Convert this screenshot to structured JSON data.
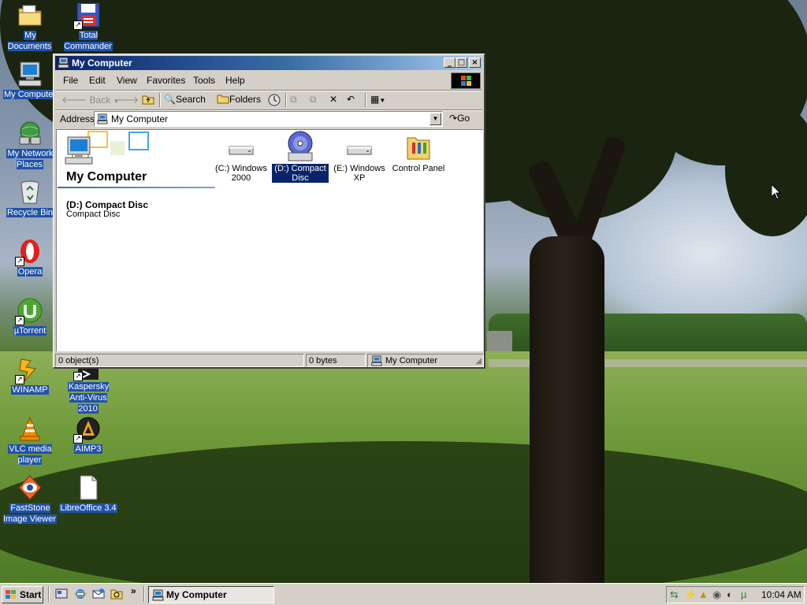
{
  "desktop": {
    "icons": [
      {
        "label": "My Documents",
        "icon": "folder-documents-icon"
      },
      {
        "label": "Total Commander",
        "icon": "floppy-disk-icon"
      },
      {
        "label": "My Computer",
        "icon": "computer-icon"
      },
      {
        "label": "My Network Places",
        "icon": "network-places-icon"
      },
      {
        "label": "Recycle Bin",
        "icon": "recycle-bin-icon"
      },
      {
        "label": "Opera",
        "icon": "opera-icon"
      },
      {
        "label": "µTorrent",
        "icon": "utorrent-icon"
      },
      {
        "label": "WINAMP",
        "icon": "winamp-icon"
      },
      {
        "label": "Kaspersky Anti-Virus 2010",
        "icon": "kaspersky-icon"
      },
      {
        "label": "VLC media player",
        "icon": "vlc-icon"
      },
      {
        "label": "AIMP3",
        "icon": "aimp-icon"
      },
      {
        "label": "FastStone Image Viewer",
        "icon": "faststone-icon"
      },
      {
        "label": "LibreOffice 3.4",
        "icon": "libreoffice-icon"
      }
    ],
    "label_highlight_color": "#2152a8"
  },
  "window": {
    "title": "My Computer",
    "title_buttons": {
      "minimize": "_",
      "maximize": "□",
      "close": "×"
    },
    "menu": [
      "File",
      "Edit",
      "View",
      "Favorites",
      "Tools",
      "Help"
    ],
    "toolbar": {
      "back": "Back",
      "search": "Search",
      "folders": "Folders"
    },
    "address": {
      "label": "Address",
      "value": "My Computer",
      "go": "Go"
    },
    "left_pane": {
      "title": "My Computer",
      "selected_name": "(D:) Compact Disc",
      "selected_type": "Compact Disc"
    },
    "items": [
      {
        "label": "(C:) Windows 2000",
        "icon": "hard-drive-icon"
      },
      {
        "label": "(D:) Compact Disc",
        "icon": "cd-drive-icon"
      },
      {
        "label": "(E:) Windows XP",
        "icon": "hard-drive-icon"
      },
      {
        "label": "Control Panel",
        "icon": "control-panel-icon"
      }
    ],
    "status": {
      "objects": "0 object(s)",
      "size": "0 bytes",
      "zone": "My Computer"
    },
    "colors": {
      "title_start": "#0a246a",
      "title_end": "#a6caf0",
      "selection": "#0a246a",
      "face": "#d4d0c8"
    }
  },
  "taskbar": {
    "start": "Start",
    "task": "My Computer",
    "more": "»",
    "clock": "10:04 AM"
  }
}
